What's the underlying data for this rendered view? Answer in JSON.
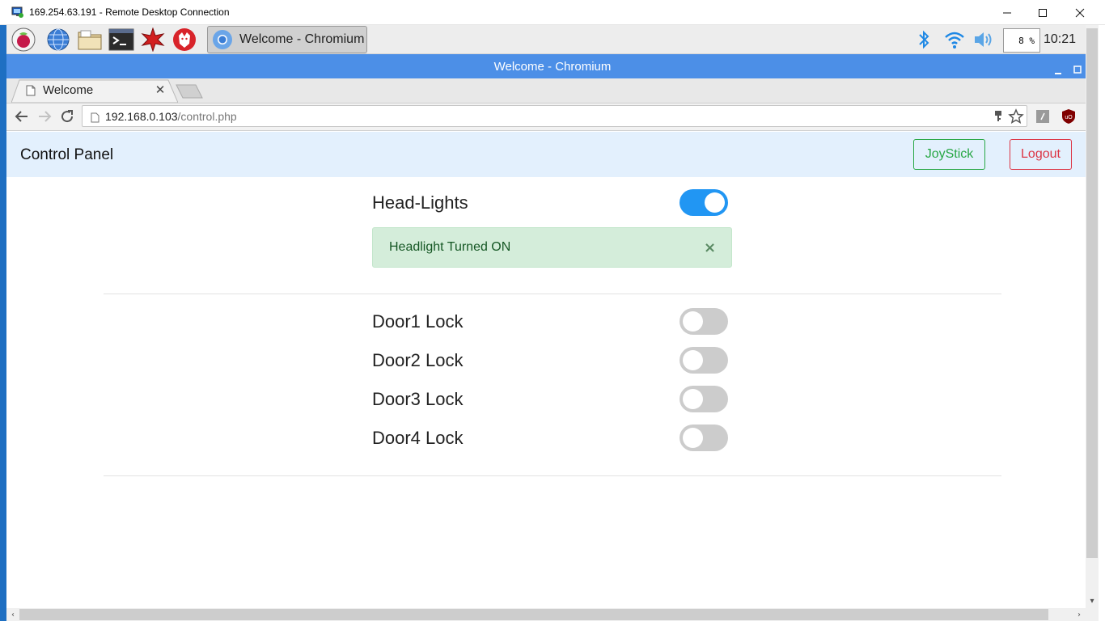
{
  "rdp": {
    "title": "169.254.63.191 - Remote Desktop Connection",
    "minimize_icon": "minimize-icon",
    "maximize_icon": "maximize-icon",
    "close_icon": "close-icon"
  },
  "taskbar": {
    "launchers": [
      "raspberry-menu-icon",
      "web-browser-icon",
      "file-manager-icon",
      "terminal-icon",
      "mathematica-icon",
      "wolfram-icon"
    ],
    "task_label": "Welcome - Chromium",
    "cpu_label": "8 %",
    "clock": "10:21",
    "tray_icons": [
      "bluetooth-icon",
      "wifi-icon",
      "volume-icon"
    ]
  },
  "browser": {
    "window_title": "Welcome - Chromium",
    "tab_label": "Welcome",
    "url_host": "192.168.0.103",
    "url_path": "/control.php",
    "accent": "#4c8fe7"
  },
  "page": {
    "brand": "Control Panel",
    "joystick_label": "JoyStick",
    "logout_label": "Logout",
    "headlights": {
      "label": "Head-Lights",
      "on": true
    },
    "alert": {
      "text": "Headlight Turned ON",
      "close": "×"
    },
    "doors": [
      {
        "label": "Door1 Lock",
        "on": false
      },
      {
        "label": "Door2 Lock",
        "on": false
      },
      {
        "label": "Door3 Lock",
        "on": false
      },
      {
        "label": "Door4 Lock",
        "on": false
      }
    ],
    "colors": {
      "toggle_on": "#2196f3",
      "toggle_off": "#cccccc",
      "success": "#28a745",
      "danger": "#dc3545"
    }
  }
}
